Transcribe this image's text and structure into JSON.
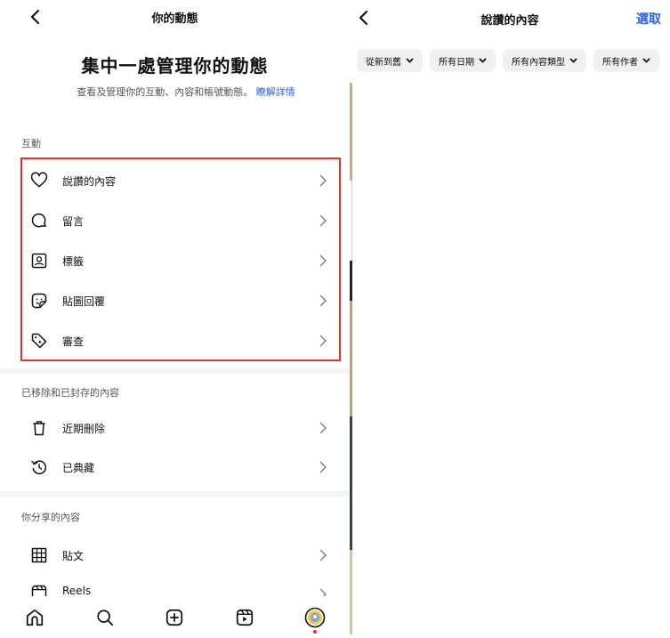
{
  "left": {
    "header_title": "你的動態",
    "hero_title": "集中一處管理你的動態",
    "hero_desc": "查看及管理你的互動、內容和帳號動態。",
    "hero_link": "瞭解詳情",
    "sections": {
      "interactions": {
        "heading": "互動",
        "items": [
          {
            "label": "說讚的內容",
            "icon": "heart-icon"
          },
          {
            "label": "留言",
            "icon": "comment-icon"
          },
          {
            "label": "標籤",
            "icon": "tag-portrait-icon"
          },
          {
            "label": "貼圖回覆",
            "icon": "sticker-icon"
          },
          {
            "label": "審查",
            "icon": "review-tag-icon"
          }
        ]
      },
      "removed": {
        "heading": "已移除和已封存的內容",
        "items": [
          {
            "label": "近期刪除",
            "icon": "trash-icon"
          },
          {
            "label": "已典藏",
            "icon": "archive-clock-icon"
          }
        ]
      },
      "shared": {
        "heading": "你分享的內容",
        "items": [
          {
            "label": "貼文",
            "icon": "grid-icon"
          },
          {
            "label": "Reels",
            "icon": "reels-icon"
          }
        ]
      }
    },
    "bottom_nav": [
      "home-icon",
      "search-icon",
      "create-icon",
      "reels-icon",
      "profile-avatar"
    ],
    "highlight_color": "#e33333"
  },
  "right": {
    "header_title": "說讚的內容",
    "select_label": "選取",
    "filters": [
      "從新到舊",
      "所有日期",
      "所有內容類型",
      "所有作者"
    ],
    "accent": "#2e63e6"
  }
}
